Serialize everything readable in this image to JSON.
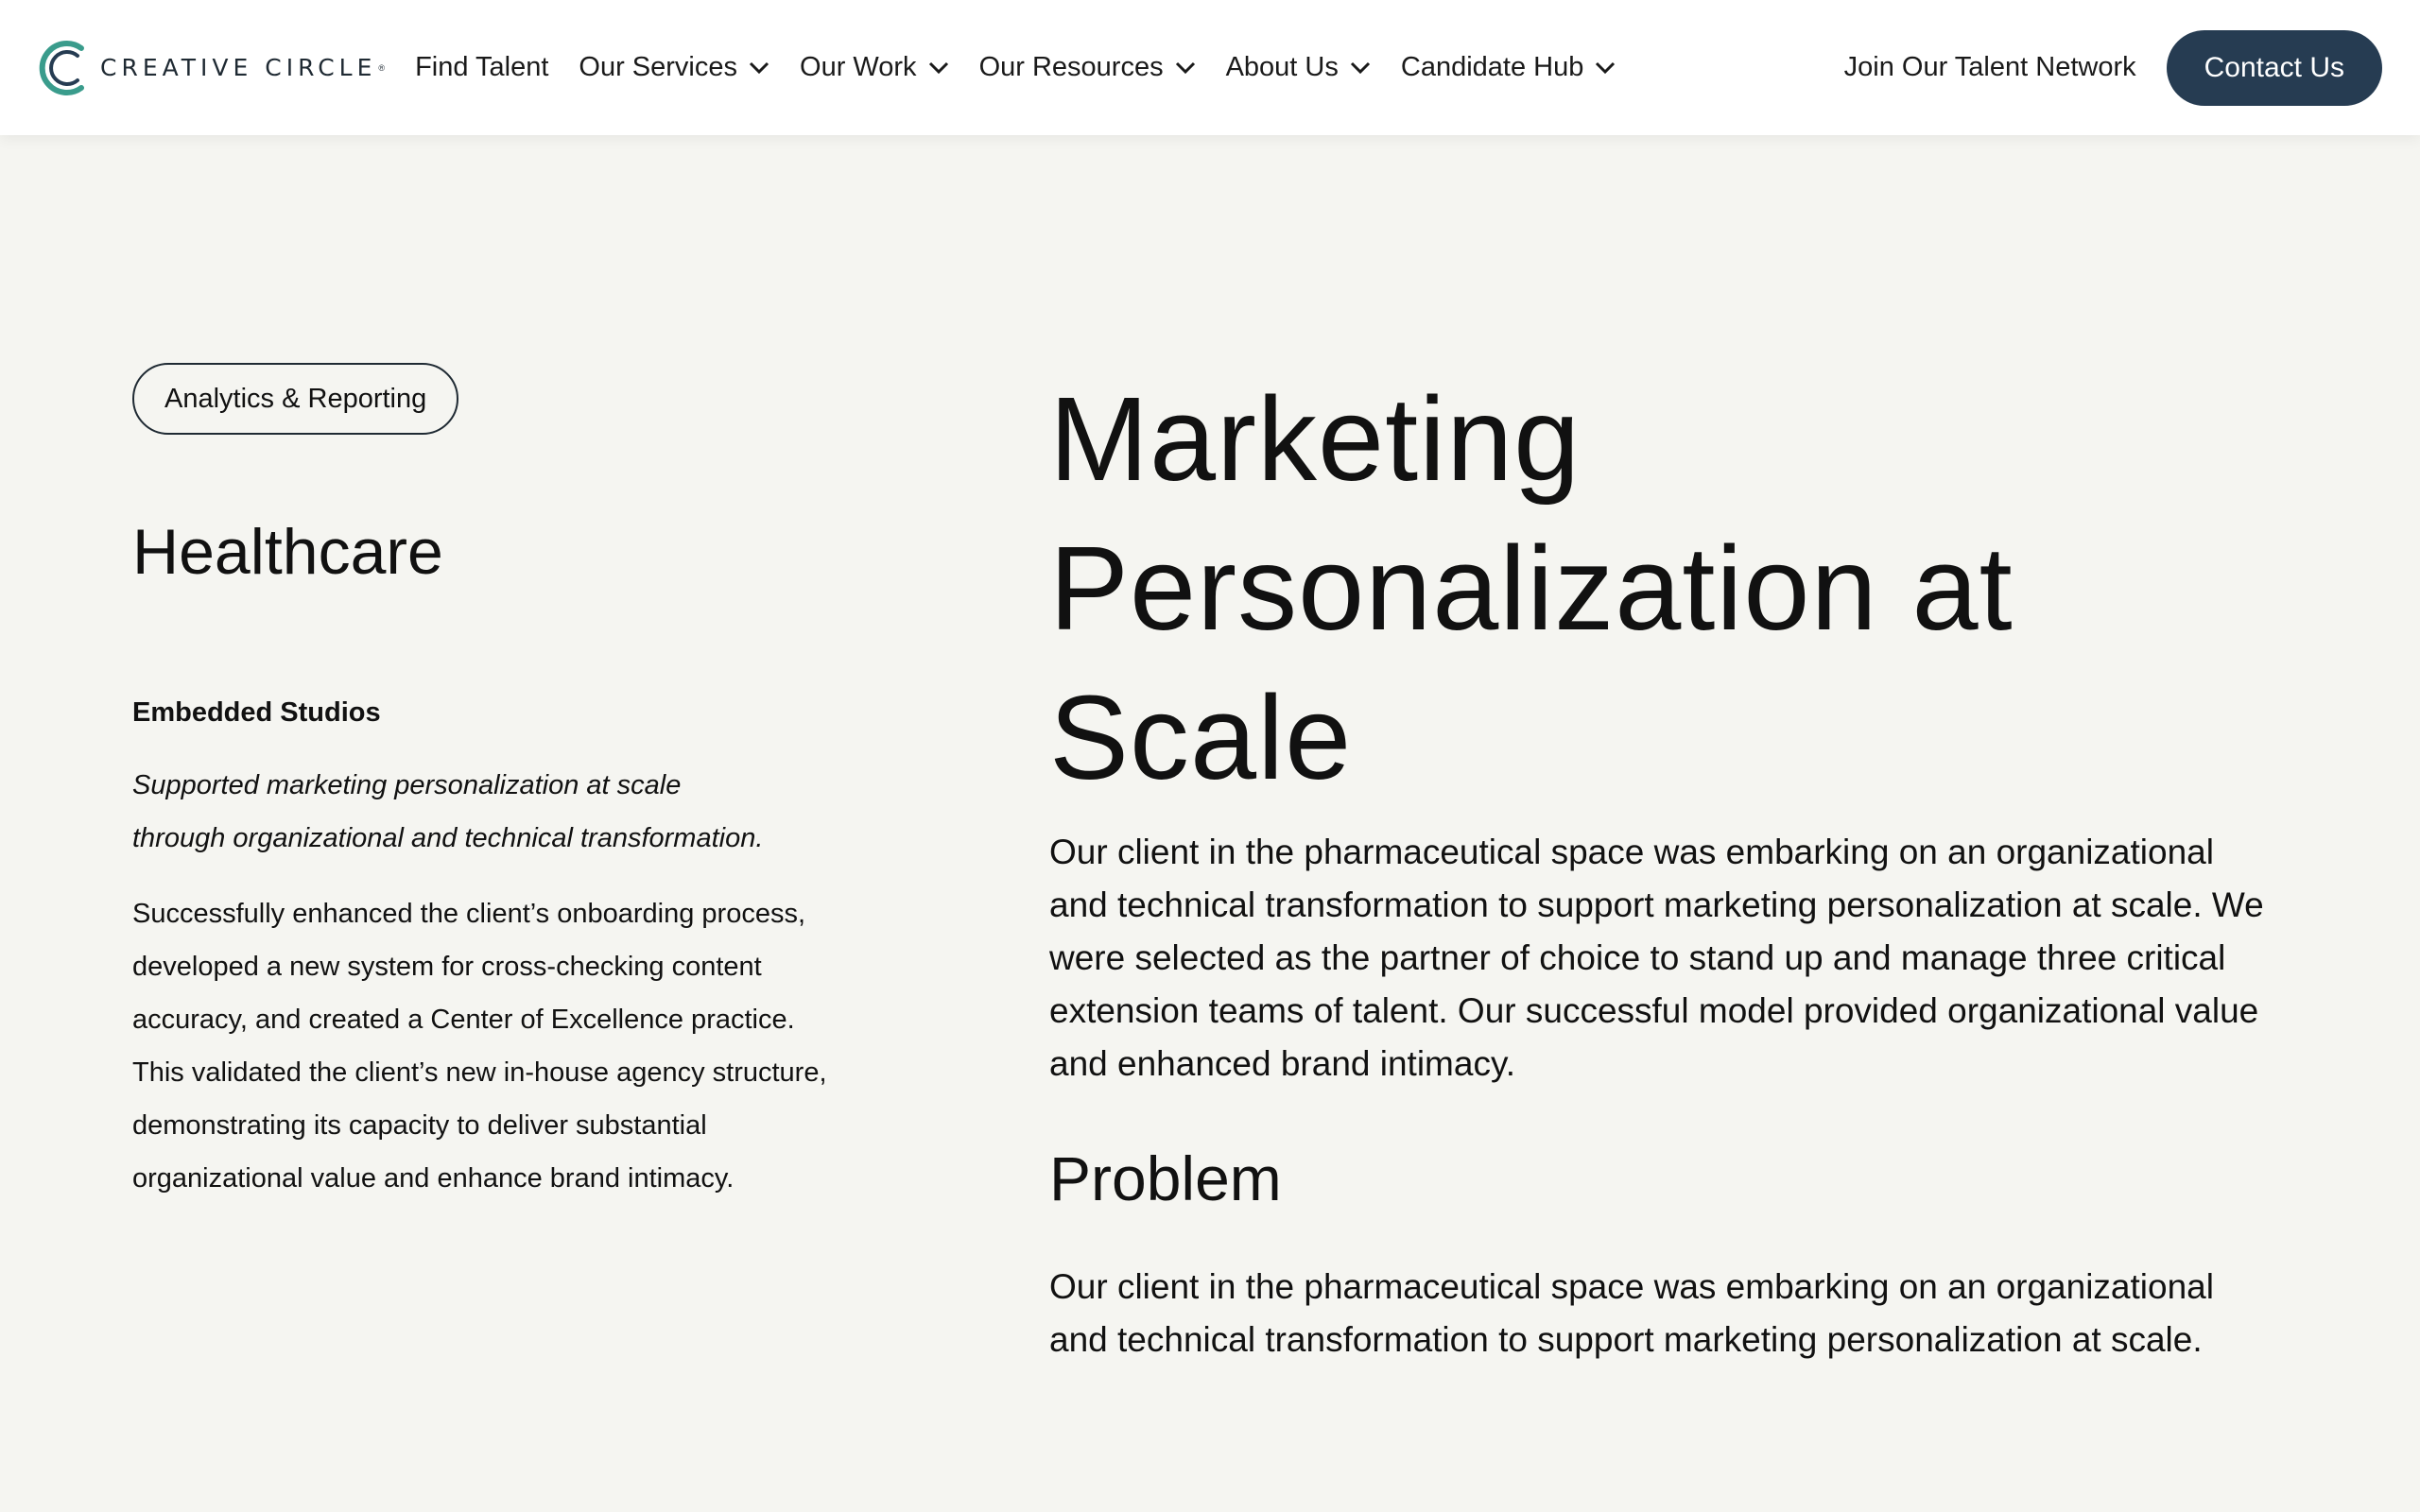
{
  "brand": {
    "logo_text": "CREATIVE CIRCLE",
    "logo_reg": "®",
    "accent_color": "#3a9c8c",
    "dark_color": "#263c52"
  },
  "nav": {
    "items": [
      {
        "label": "Find Talent",
        "has_dropdown": false
      },
      {
        "label": "Our Services",
        "has_dropdown": true
      },
      {
        "label": "Our Work",
        "has_dropdown": true
      },
      {
        "label": "Our Resources",
        "has_dropdown": true
      },
      {
        "label": "About Us",
        "has_dropdown": true
      },
      {
        "label": "Candidate Hub",
        "has_dropdown": true
      }
    ],
    "join_label": "Join Our Talent Network",
    "contact_label": "Contact Us"
  },
  "sidebar": {
    "tag": "Analytics & Reporting",
    "industry": "Healthcare",
    "studio": "Embedded Studios",
    "summary_italic": "Supported marketing personalization at scale through organizational and technical transformation.",
    "summary_body": "Successfully enhanced the client’s onboarding process, developed a new system for cross-checking content accuracy, and created a Center of Excellence practice. This validated the client’s new in-house agency structure, demonstrating its capacity to deliver substantial organizational value and enhance brand intimacy."
  },
  "article": {
    "title": "Marketing Personalization at Scale",
    "intro": "Our client in the pharmaceutical space was embarking on an organizational and technical transformation to support marketing personalization at scale. We were selected as the partner of choice to stand up and manage three critical extension teams of talent. Our successful model provided organizational value and enhanced brand intimacy.",
    "problem_heading": "Problem",
    "problem_body": "Our client in the pharmaceutical space was embarking on an organizational and technical transformation to support marketing personalization at scale."
  }
}
